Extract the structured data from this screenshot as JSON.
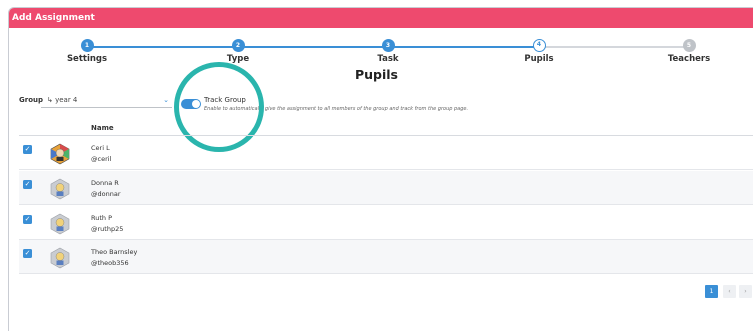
{
  "modal": {
    "title": "Add Assignment"
  },
  "stepper": {
    "steps": [
      {
        "number": "1",
        "label": "Settings",
        "state": "done"
      },
      {
        "number": "2",
        "label": "Type",
        "state": "done"
      },
      {
        "number": "3",
        "label": "Task",
        "state": "done"
      },
      {
        "number": "4",
        "label": "Pupils",
        "state": "current"
      },
      {
        "number": "5",
        "label": "Teachers",
        "state": "todo"
      }
    ]
  },
  "page": {
    "title": "Pupils"
  },
  "group": {
    "label": "Group",
    "selected": "↳ year 4",
    "chevron_icon": "chevron-down-icon"
  },
  "track_group": {
    "title": "Track Group",
    "description": "Enable to automatically give the assignment to all members of the group and track from the group page.",
    "enabled": true
  },
  "table": {
    "column_name": "Name",
    "rows": [
      {
        "name": "Ceri L",
        "handle": "@ceril",
        "checked": true,
        "avatar_icon": "colorful-hexagon-avatar"
      },
      {
        "name": "Donna R",
        "handle": "@donnar",
        "checked": true,
        "avatar_icon": "hexagon-avatar"
      },
      {
        "name": "Ruth P",
        "handle": "@ruthp25",
        "checked": true,
        "avatar_icon": "hexagon-avatar"
      },
      {
        "name": "Theo Barnsley",
        "handle": "@theob356",
        "checked": true,
        "avatar_icon": "hexagon-avatar"
      }
    ]
  },
  "pagination": {
    "current": "1",
    "prev_icon": "chevron-left-icon",
    "next_icon": "chevron-right-icon"
  },
  "colors": {
    "header": "#ee4a6e",
    "accent": "#3a8fd6",
    "highlight_ring": "#2ab5ad"
  }
}
